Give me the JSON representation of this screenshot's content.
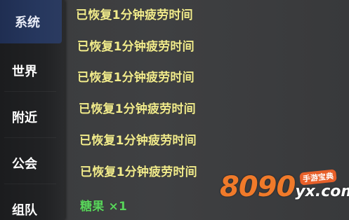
{
  "sidebar": {
    "tabs": [
      {
        "label": "系统",
        "active": true
      },
      {
        "label": "世界",
        "active": false
      },
      {
        "label": "附近",
        "active": false
      },
      {
        "label": "公会",
        "active": false
      },
      {
        "label": "组队",
        "active": false
      }
    ]
  },
  "messages": [
    {
      "text": "已恢复1分钟疲劳时间",
      "color": "#f2ec8c"
    },
    {
      "text": "已恢复1分钟疲劳时间",
      "color": "#f2ec8c"
    },
    {
      "text": "已恢复1分钟疲劳时间",
      "color": "#f2ec8c"
    },
    {
      "text": "已恢复1分钟疲劳时间",
      "color": "#f2ec8c"
    },
    {
      "text": "已恢复1分钟疲劳时间",
      "color": "#f2ec8c"
    },
    {
      "text": "已恢复1分钟疲劳时间",
      "color": "#f2ec8c"
    },
    {
      "text": "糖果 ×1",
      "color": "#59d45b"
    }
  ],
  "watermark": {
    "brand": "8090",
    "domain": "yx.com",
    "tag": "手游宝典"
  },
  "colors": {
    "active_tab": "#26375e",
    "system_text": "#f2ec8c",
    "reward_text": "#59d45b",
    "brand_orange": "#f07a2a"
  }
}
